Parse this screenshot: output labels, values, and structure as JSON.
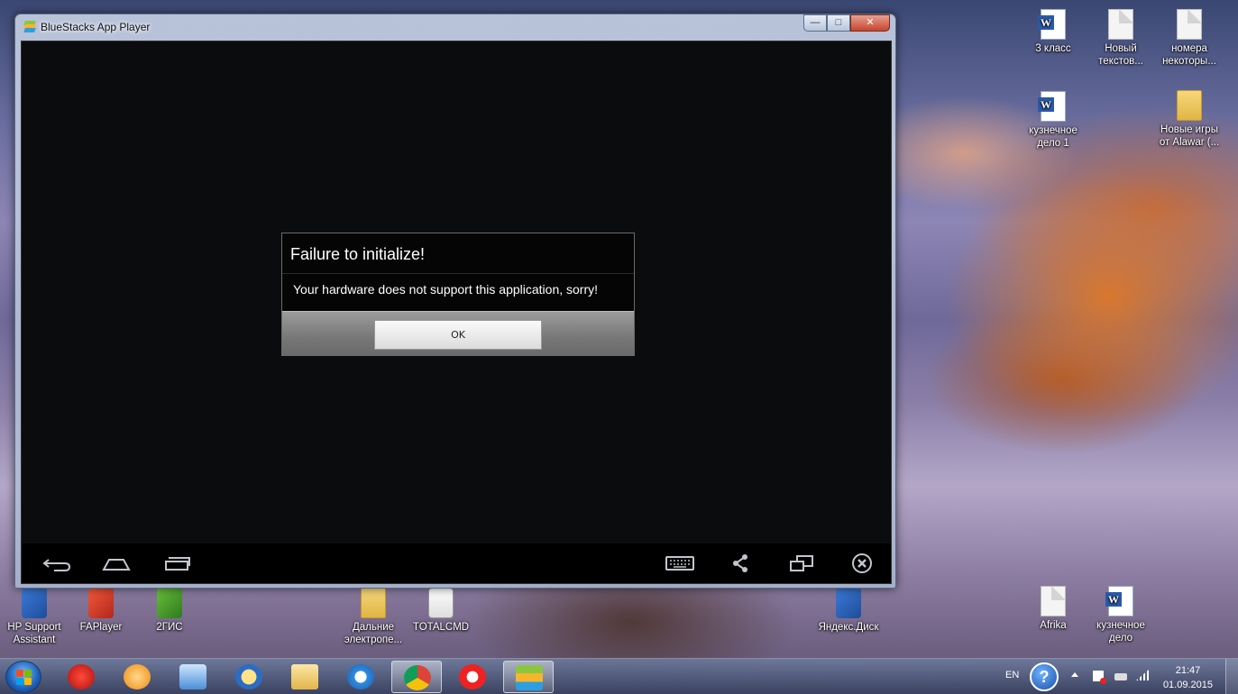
{
  "window": {
    "title": "BlueStacks App Player",
    "minimize": "—",
    "maximize": "□",
    "close": "✕"
  },
  "dialog": {
    "title": "Failure to initialize!",
    "message": "Your hardware does not support this application, sorry!",
    "ok_label": "OK"
  },
  "android_nav": {
    "icons": [
      "back-icon",
      "home-icon",
      "recent-apps-icon",
      "keyboard-icon",
      "share-icon",
      "multi-window-icon",
      "close-app-icon"
    ]
  },
  "desktop_icons": [
    {
      "label": "3 класс",
      "icon": "word-document-icon"
    },
    {
      "label": "Новый текстов...",
      "icon": "text-document-icon"
    },
    {
      "label": "номера некоторы...",
      "icon": "text-document-icon"
    },
    {
      "label": "кузнечное дело 1",
      "icon": "word-document-icon"
    },
    {
      "label": "Новые игры от Alawar (...",
      "icon": "folder-icon"
    },
    {
      "label": "HP Support Assistant",
      "icon": "shortcut-icon"
    },
    {
      "label": "FAPlayer",
      "icon": "shortcut-icon"
    },
    {
      "label": "2ГИС",
      "icon": "shortcut-icon"
    },
    {
      "label": "Дальние электропе...",
      "icon": "folder-icon"
    },
    {
      "label": "TOTALCMD",
      "icon": "shortcut-icon"
    },
    {
      "label": "Яндекс.Диск",
      "icon": "shortcut-icon"
    },
    {
      "label": "Afrika",
      "icon": "text-document-icon"
    },
    {
      "label": "кузнечное дело",
      "icon": "word-document-icon"
    }
  ],
  "taskbar": {
    "pinned": [
      "antivirus-icon",
      "media-player-icon",
      "speaker-app-icon",
      "mail-icon",
      "explorer-icon",
      "internet-explorer-icon",
      "chrome-icon",
      "yandex-browser-icon",
      "bluestacks-icon"
    ],
    "language": "EN",
    "help": "?",
    "time": "21:47",
    "date": "01.09.2015"
  }
}
